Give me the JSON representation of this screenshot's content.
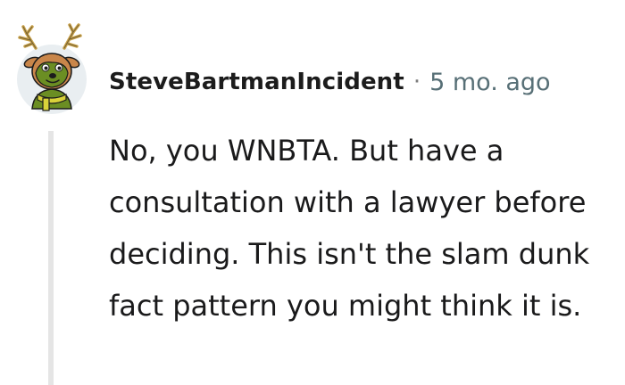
{
  "comment": {
    "author": "SteveBartmanIncident",
    "separator": "·",
    "timestamp": "5 mo. ago",
    "body": "No, you WNBTA. But have a consultation with a lawyer before deciding. This isn't the slam dunk fact pattern you might think it is.",
    "avatar_icon": "reindeer-avatar-icon"
  },
  "colors": {
    "author": "#1c1c1c",
    "timestamp": "#576f76",
    "thread_line": "#e5e5e5",
    "avatar_bg": "#e9eef1",
    "avatar_face": "#6b8e23"
  }
}
